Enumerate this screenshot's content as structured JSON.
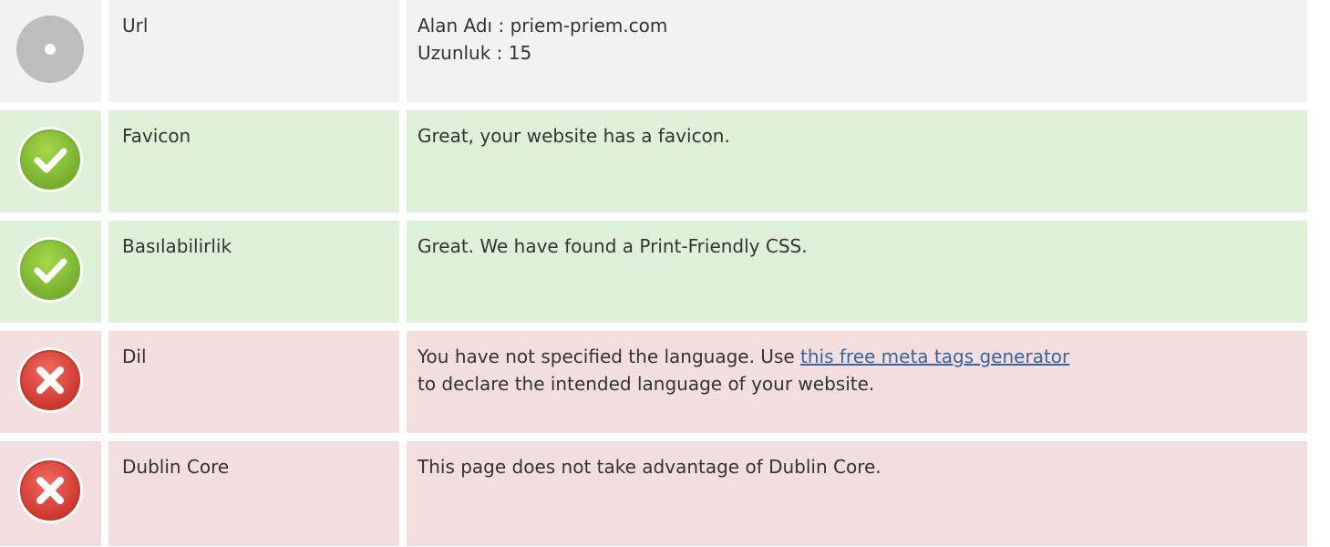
{
  "rows": [
    {
      "status": "neutral",
      "icon": "neutral-circle-icon",
      "label": "Url",
      "lines": [
        "Alan Adı : priem-priem.com",
        "Uzunluk : 15"
      ]
    },
    {
      "status": "pass",
      "icon": "check-circle-icon",
      "label": "Favicon",
      "text": "Great, your website has a favicon."
    },
    {
      "status": "pass",
      "icon": "check-circle-icon",
      "label": "Basılabilirlik",
      "text": "Great. We have found a Print-Friendly CSS."
    },
    {
      "status": "fail",
      "icon": "cross-circle-icon",
      "label": "Dil",
      "text_before": "You have not specified the language. Use ",
      "link_text": "this free meta tags generator",
      "text_after": "to declare the intended language of your website."
    },
    {
      "status": "fail",
      "icon": "cross-circle-icon",
      "label": "Dublin Core",
      "text": "This page does not take advantage of Dublin Core."
    }
  ],
  "colors": {
    "neutral_bg": "#f2f2f2",
    "pass_bg": "#dff0d8",
    "fail_bg": "#f2dede",
    "link": "#39649b"
  }
}
